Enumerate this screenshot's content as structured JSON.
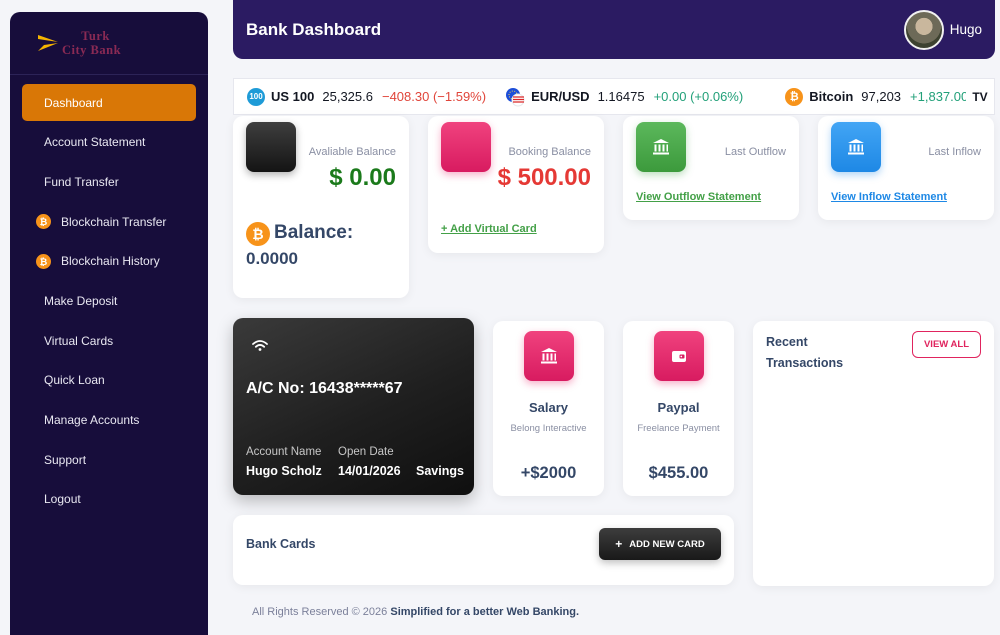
{
  "brand": {
    "line1": "Turk",
    "line2": "City Bank"
  },
  "sidebar": {
    "items": [
      {
        "label": "Dashboard",
        "active": true
      },
      {
        "label": "Account Statement"
      },
      {
        "label": "Fund Transfer"
      },
      {
        "label": "Blockchain Transfer",
        "icon": "bitcoin-icon"
      },
      {
        "label": "Blockchain History",
        "icon": "bitcoin-icon"
      },
      {
        "label": "Make Deposit"
      },
      {
        "label": "Virtual Cards"
      },
      {
        "label": "Quick Loan"
      },
      {
        "label": "Manage Accounts"
      },
      {
        "label": "Support"
      },
      {
        "label": "Logout"
      }
    ]
  },
  "header": {
    "title": "Bank Dashboard",
    "user_name": "Hugo"
  },
  "ticker": [
    {
      "badge": "100",
      "symbol": "US 100",
      "price": "25,325.6",
      "change": "−408.30 (−1.59%)",
      "direction": "down"
    },
    {
      "symbol": "EUR/USD",
      "price": "1.16475",
      "change": "+0.00 (+0.06%)",
      "direction": "up"
    },
    {
      "badge": "₿",
      "symbol": "Bitcoin",
      "price": "97,203",
      "change": "+1,837.00 (+",
      "direction": "up"
    }
  ],
  "tradingview_logo": "TV",
  "stats": {
    "available": {
      "label": "Avaliable Balance",
      "value": "$ 0.00"
    },
    "booking": {
      "label": "Booking Balance",
      "value": "$ 500.00",
      "link": "+ Add Virtual Card"
    },
    "outflow": {
      "label": "Last Outflow",
      "link": "View Outflow Statement"
    },
    "inflow": {
      "label": "Last Inflow",
      "link": "View Inflow Statement"
    },
    "btc": {
      "label": "Balance:",
      "value": "0.0000"
    }
  },
  "bank_card": {
    "account_no": "A/C No: 16438*****67",
    "account_name_label": "Account Name",
    "account_name": "Hugo Scholz",
    "open_date_label": "Open Date",
    "open_date": "14/01/2026",
    "type": "Savings"
  },
  "salary": {
    "title": "Salary",
    "subtitle": "Belong Interactive",
    "amount": "+$2000"
  },
  "paypal": {
    "title": "Paypal",
    "subtitle": "Freelance Payment",
    "amount": "$455.00"
  },
  "recent": {
    "title": "Recent Transactions",
    "button": "VIEW ALL"
  },
  "bank_cards": {
    "title": "Bank Cards",
    "button": "ADD NEW CARD",
    "button_icon": "+"
  },
  "footer": {
    "text": "All Rights Reserved © 2026",
    "tagline": "Simplified for a better Web Banking."
  },
  "colors": {
    "accent": "#d97706",
    "header": "#2b1b62",
    "sidebar": "#170d3b",
    "pink": "#e91e63",
    "green": "#43a047",
    "blue": "#1e88e5",
    "danger": "#e53935",
    "success": "#1b7a1b"
  }
}
